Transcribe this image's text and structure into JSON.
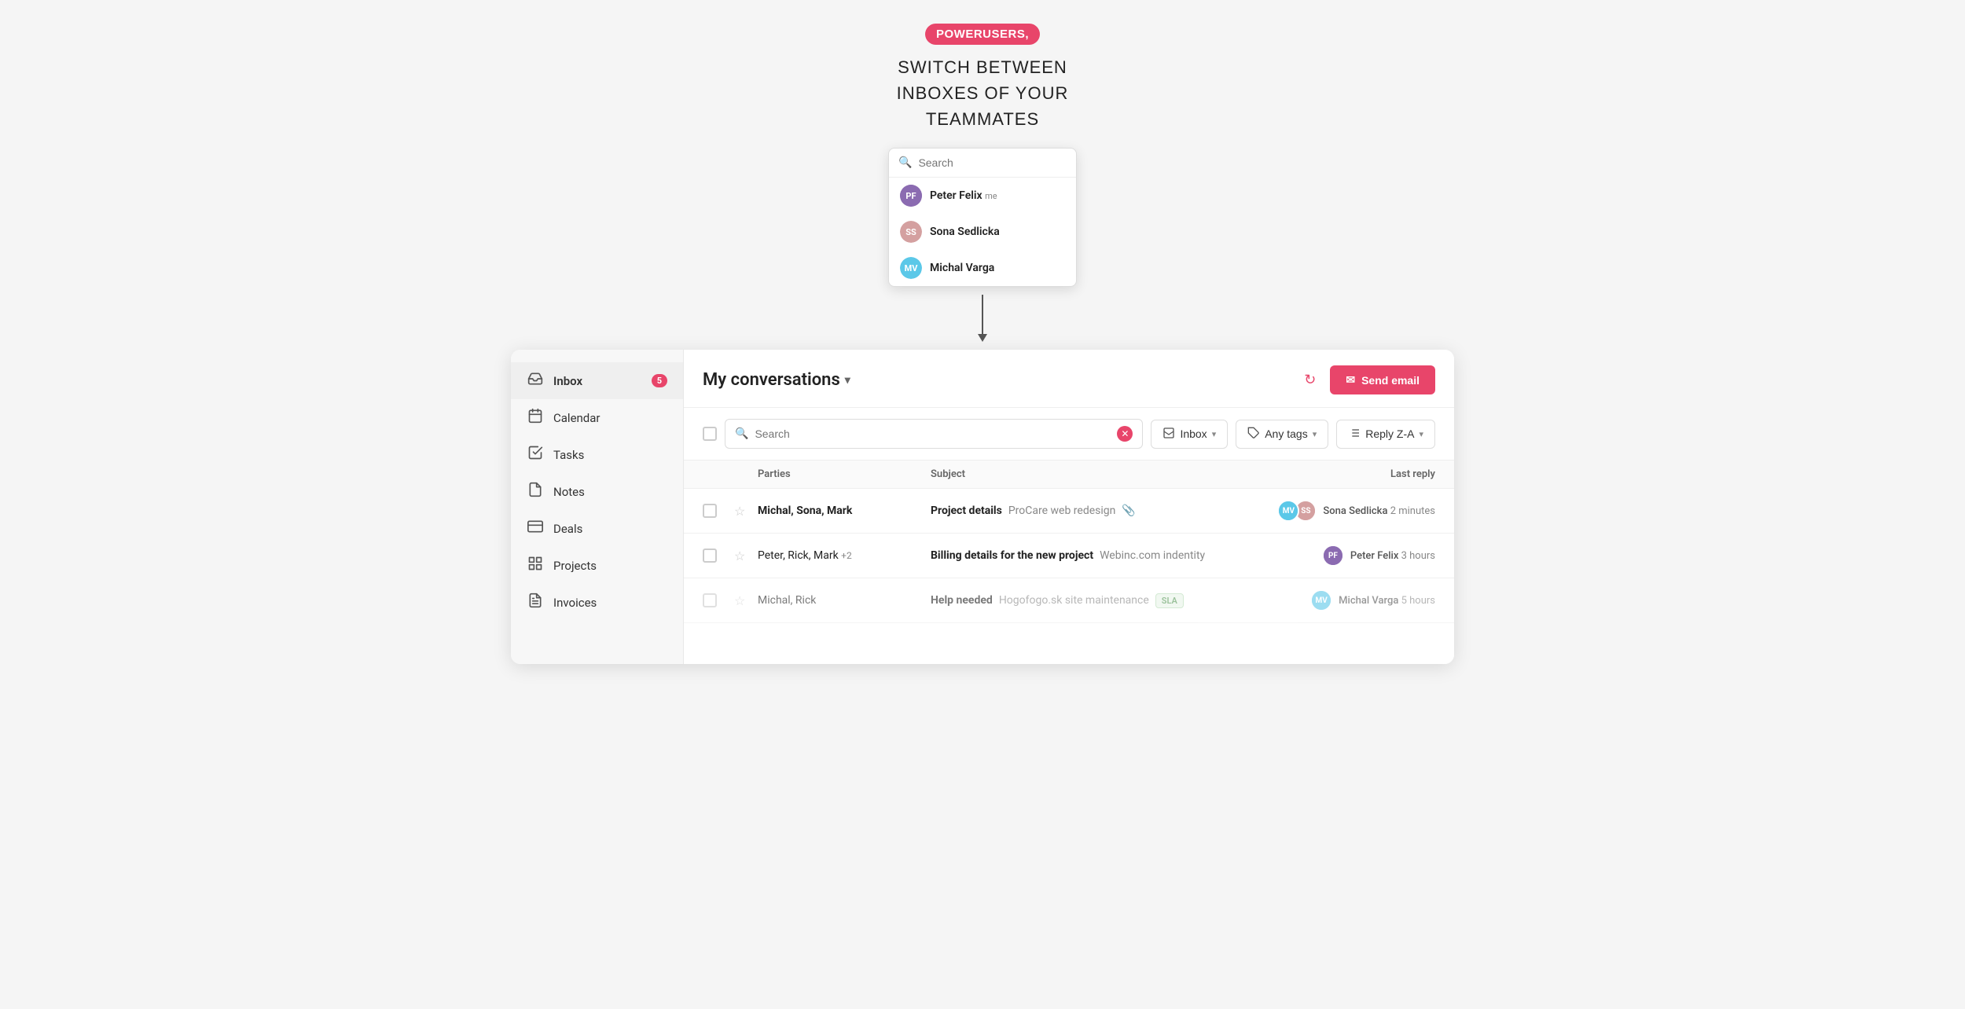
{
  "top": {
    "badge": "POWERUSERS,",
    "line1": "SWITCH BETWEEN",
    "line2": "INBOXES OF YOUR",
    "line3": "TEAMMATES"
  },
  "dropdown": {
    "search_placeholder": "Search",
    "users": [
      {
        "id": "pf",
        "name": "Peter Felix",
        "badge": "me",
        "initials": "PF",
        "color": "#8b6bb1"
      },
      {
        "id": "ss",
        "name": "Sona Sedlicka",
        "badge": "",
        "initials": "SS",
        "color": "#d4a0a0"
      },
      {
        "id": "mv",
        "name": "Michal Varga",
        "badge": "",
        "initials": "MV",
        "color": "#5bc8e8"
      }
    ]
  },
  "sidebar": {
    "items": [
      {
        "id": "inbox",
        "label": "Inbox",
        "icon": "📥",
        "badge": "5",
        "active": true
      },
      {
        "id": "calendar",
        "label": "Calendar",
        "icon": "📅",
        "badge": ""
      },
      {
        "id": "tasks",
        "label": "Tasks",
        "icon": "✅",
        "badge": ""
      },
      {
        "id": "notes",
        "label": "Notes",
        "icon": "📄",
        "badge": ""
      },
      {
        "id": "deals",
        "label": "Deals",
        "icon": "🏷️",
        "badge": ""
      },
      {
        "id": "projects",
        "label": "Projects",
        "icon": "📋",
        "badge": ""
      },
      {
        "id": "invoices",
        "label": "Invoices",
        "icon": "🧾",
        "badge": ""
      }
    ]
  },
  "main": {
    "title": "My conversations",
    "refresh_label": "↻",
    "send_email_label": "Send email",
    "send_email_icon": "✉",
    "filters": {
      "search_value": "Search",
      "inbox_label": "Inbox",
      "any_tags_label": "Any tags",
      "reply_sort_label": "Reply Z-A"
    },
    "table_headers": {
      "parties": "Parties",
      "subject": "Subject",
      "last_reply": "Last reply"
    },
    "conversations": [
      {
        "parties": "Michal, Sona, Mark",
        "parties_extra": "",
        "subject": "Project details",
        "preview": "ProCare web redesign",
        "has_attachment": true,
        "tag": "",
        "avatars": [
          "mv",
          "ss"
        ],
        "reply_name": "Sona Sedlicka",
        "reply_time": "2 minutes",
        "bold": true
      },
      {
        "parties": "Peter, Rick, Mark",
        "parties_extra": "+2",
        "subject": "Billing details for the new project",
        "preview": "Webinc.com indentity",
        "has_attachment": false,
        "tag": "",
        "avatars": [
          "pf"
        ],
        "reply_name": "Peter Felix",
        "reply_time": "3 hours",
        "bold": false
      },
      {
        "parties": "Michal, Rick",
        "parties_extra": "",
        "subject": "Help needed",
        "preview": "Hogofogo.sk site maintenance",
        "has_attachment": false,
        "tag": "SLA",
        "avatars": [
          "mv"
        ],
        "reply_name": "Michal Varga",
        "reply_time": "5 hours",
        "bold": false
      }
    ]
  },
  "avatar_colors": {
    "mv": "#5bc8e8",
    "ss": "#d4a0a0",
    "pf": "#8b6bb1"
  },
  "avatar_initials": {
    "mv": "MV",
    "ss": "SS",
    "pf": "PF"
  }
}
